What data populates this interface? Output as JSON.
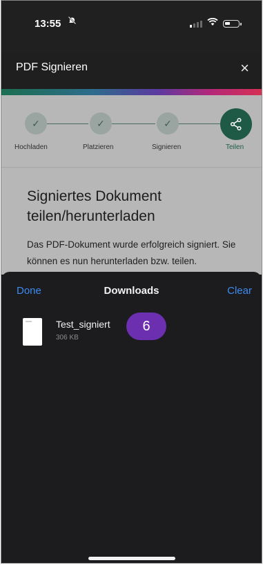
{
  "status_bar": {
    "time": "13:55",
    "bell_icon": "bell-mute-icon"
  },
  "app_header": {
    "title": "PDF Signieren",
    "close_icon": "×"
  },
  "stepper": {
    "steps": [
      {
        "label": "Hochladen",
        "state": "done"
      },
      {
        "label": "Platzieren",
        "state": "done"
      },
      {
        "label": "Signieren",
        "state": "done"
      },
      {
        "label": "Teilen",
        "state": "active"
      }
    ],
    "done_glyph": "✓",
    "active_icon": "share-icon"
  },
  "main": {
    "heading": "Signiertes Dokument teilen/herunterladen",
    "description": "Das PDF-Dokument wurde erfolgreich signiert. Sie können es nun herunterladen bzw. teilen."
  },
  "downloads_sheet": {
    "done_label": "Done",
    "title": "Downloads",
    "clear_label": "Clear",
    "files": [
      {
        "name": "Test_signiert",
        "size": "306 KB"
      }
    ]
  },
  "annotation": {
    "step_badge": "6"
  },
  "colors": {
    "accent_green": "#1e5a45",
    "ios_blue": "#3b8bf0",
    "badge_purple": "#6b2fb0"
  }
}
